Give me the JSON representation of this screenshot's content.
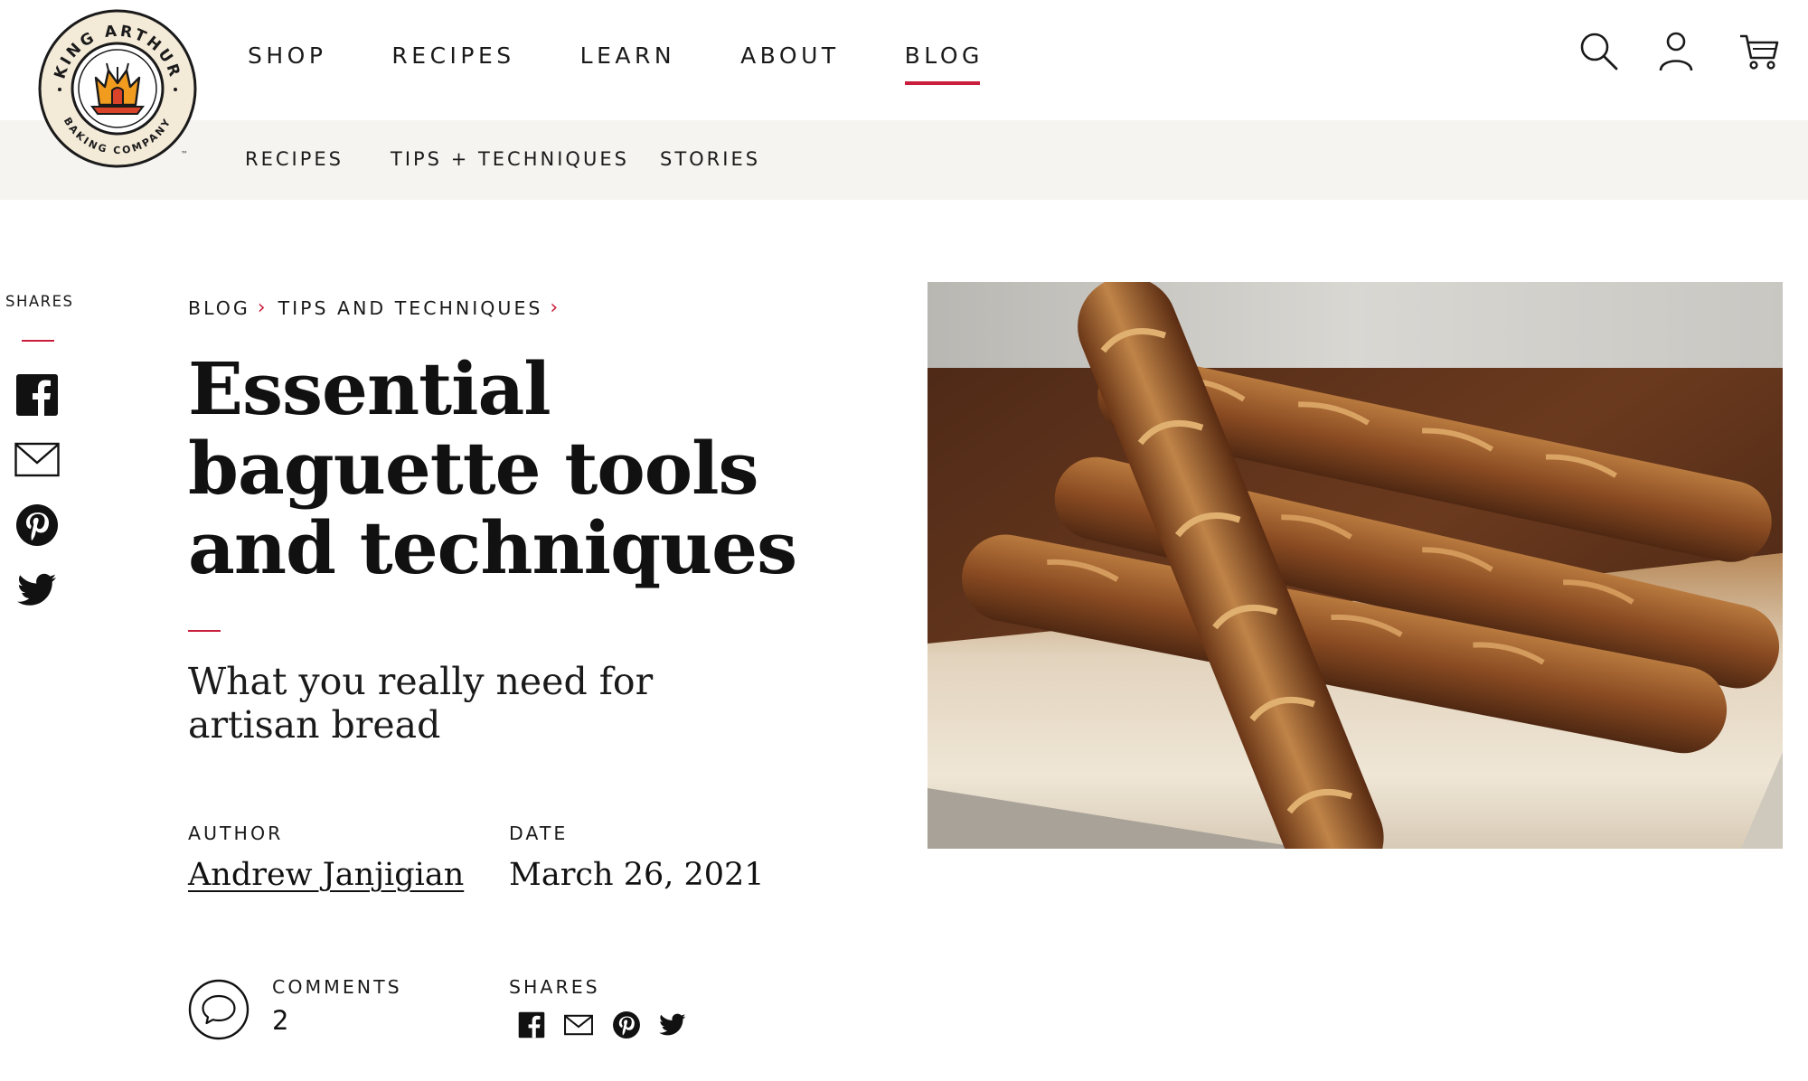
{
  "header": {
    "logo": {
      "text_top": "KING ARTHUR",
      "text_bottom": "BAKING COMPANY",
      "trademark": "™"
    },
    "nav": [
      {
        "label": "SHOP"
      },
      {
        "label": "RECIPES"
      },
      {
        "label": "LEARN"
      },
      {
        "label": "ABOUT"
      },
      {
        "label": "BLOG",
        "active": true
      }
    ],
    "icons": [
      "search-icon",
      "account-icon",
      "cart-icon"
    ]
  },
  "subnav": [
    {
      "label": "RECIPES"
    },
    {
      "label": "TIPS + TECHNIQUES"
    },
    {
      "label": "STORIES"
    }
  ],
  "share_rail": {
    "label": "SHARES",
    "icons": [
      "facebook-icon",
      "email-icon",
      "pinterest-icon",
      "twitter-icon"
    ]
  },
  "breadcrumb": [
    {
      "label": "BLOG"
    },
    {
      "label": "TIPS AND TECHNIQUES"
    }
  ],
  "article": {
    "title": "Essential baguette tools and techniques",
    "subtitle": "What you really need for artisan bread",
    "author_label": "AUTHOR",
    "author": "Andrew Janjigian",
    "date_label": "DATE",
    "date": "March 26, 2021",
    "comments_label": "COMMENTS",
    "comments_count": "2",
    "shares_label": "SHARES"
  },
  "colors": {
    "accent": "#c81e3c",
    "subnav_bg": "#f6f4f1",
    "text": "#111111"
  }
}
